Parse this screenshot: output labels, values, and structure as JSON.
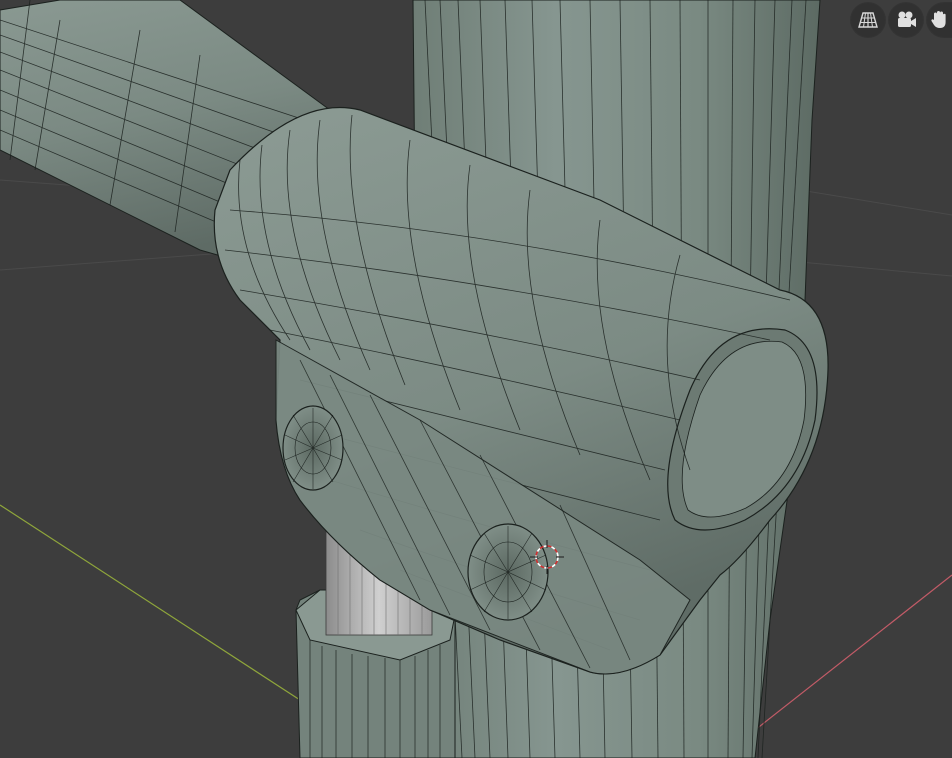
{
  "viewport": {
    "background_color": "#3d3d3d",
    "mesh_color": "#7d8c84",
    "mesh_shadow_color": "#55625b",
    "wire_color": "#1b211e",
    "axis_x_color": "#c25b67",
    "axis_y_color": "#8fa63b",
    "grid_color": "#4a4a4a",
    "cursor_colors": [
      "#d03030",
      "#ffffff"
    ],
    "shading_mode": "solid-wireframe-overlay"
  },
  "navigation_gizmo": {
    "buttons": [
      {
        "name": "toggle-perspective-ortho",
        "icon": "grid-perspective-icon"
      },
      {
        "name": "toggle-camera-view",
        "icon": "camera-icon"
      },
      {
        "name": "move-view",
        "icon": "hand-icon"
      }
    ]
  }
}
